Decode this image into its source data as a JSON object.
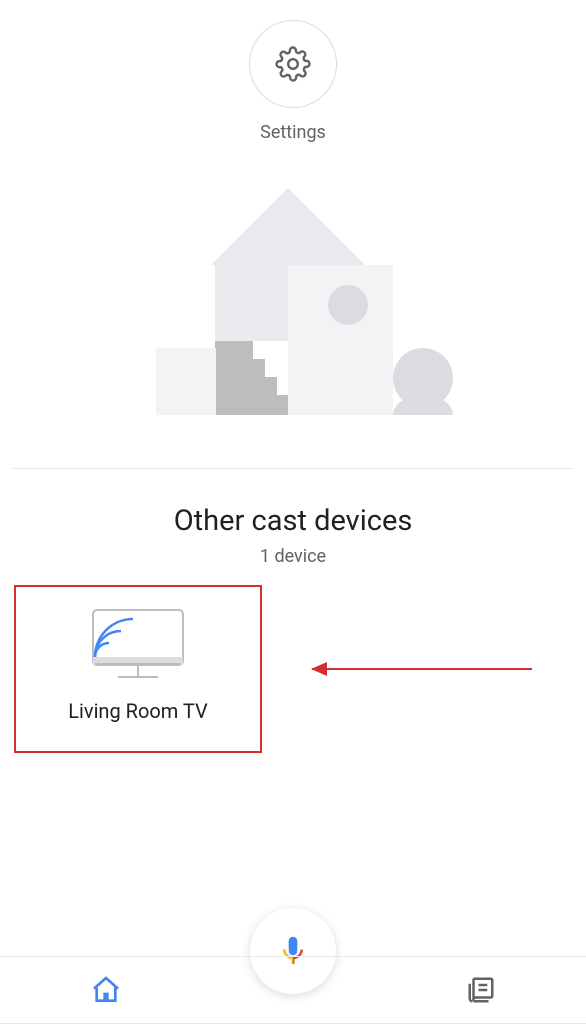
{
  "settings": {
    "label": "Settings"
  },
  "section": {
    "title": "Other cast devices",
    "subtitle": "1 device"
  },
  "devices": [
    {
      "name": "Living Room TV"
    }
  ],
  "colors": {
    "accent": "#4285F4",
    "highlight": "#d32f2f",
    "gray_light": "#e8eaed",
    "gray_mid": "#bdbdbd",
    "gray_dark": "#5f6368"
  }
}
